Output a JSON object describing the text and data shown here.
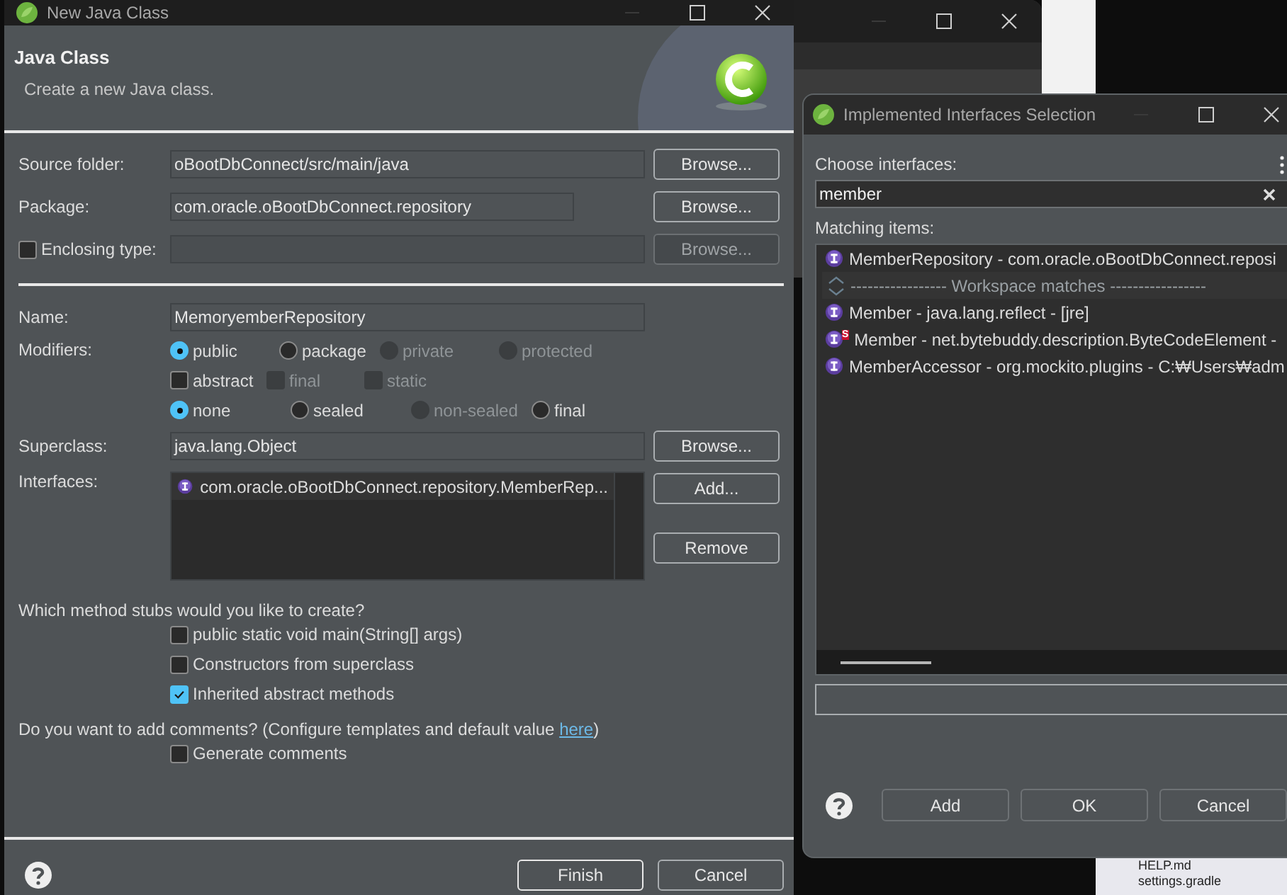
{
  "background": {
    "tree_items": [
      "HELP.md",
      "settings.gradle"
    ]
  },
  "main_dialog": {
    "title": "New Java Class",
    "header": {
      "title": "Java Class",
      "subtitle": "Create a new Java class."
    },
    "source_folder": {
      "label": "Source folder:",
      "value": "oBootDbConnect/src/main/java",
      "button": "Browse..."
    },
    "package": {
      "label": "Package:",
      "value": "com.oracle.oBootDbConnect.repository",
      "button": "Browse..."
    },
    "enclosing_type": {
      "label": "Enclosing type:",
      "checked": false,
      "button": "Browse...",
      "disabled": true
    },
    "name": {
      "label": "Name:",
      "value": "MemoryemberRepository"
    },
    "modifiers": {
      "label": "Modifiers:",
      "visibility": [
        {
          "label": "public",
          "selected": true,
          "disabled": false
        },
        {
          "label": "package",
          "selected": false,
          "disabled": false
        },
        {
          "label": "private",
          "selected": false,
          "disabled": true
        },
        {
          "label": "protected",
          "selected": false,
          "disabled": true
        }
      ],
      "flags": [
        {
          "label": "abstract",
          "checked": false,
          "disabled": false
        },
        {
          "label": "final",
          "checked": false,
          "disabled": true
        },
        {
          "label": "static",
          "checked": false,
          "disabled": true
        }
      ],
      "sealing": [
        {
          "label": "none",
          "selected": true,
          "disabled": false
        },
        {
          "label": "sealed",
          "selected": false,
          "disabled": false
        },
        {
          "label": "non-sealed",
          "selected": false,
          "disabled": true
        },
        {
          "label": "final",
          "selected": false,
          "disabled": false
        }
      ]
    },
    "superclass": {
      "label": "Superclass:",
      "value": "java.lang.Object",
      "button": "Browse..."
    },
    "interfaces": {
      "label": "Interfaces:",
      "items": [
        "com.oracle.oBootDbConnect.repository.MemberRep..."
      ],
      "buttons": [
        "Add...",
        "Remove"
      ]
    },
    "stubs_question": "Which method stubs would you like to create?",
    "stubs": [
      {
        "label": "public static void main(String[] args)",
        "checked": false
      },
      {
        "label": "Constructors from superclass",
        "checked": false
      },
      {
        "label": "Inherited abstract methods",
        "checked": true
      }
    ],
    "comments_question": "Do you want to add comments? (Configure templates and default value ",
    "comments_link": "here",
    "comments_question_end": ")",
    "comments": [
      {
        "label": "Generate comments",
        "checked": false
      }
    ],
    "buttons": [
      {
        "label": "Finish",
        "default": true
      },
      {
        "label": "Cancel",
        "default": false
      }
    ]
  },
  "interfaces_dialog": {
    "title": "Implemented Interfaces Selection",
    "prompt": "Choose interfaces:",
    "search": {
      "value": "member"
    },
    "matching_label": "Matching items:",
    "items": [
      {
        "kind": "interface",
        "name": "MemberRepository",
        "detail": " - com.oracle.oBootDbConnect.reposi",
        "selected": false
      },
      {
        "kind": "separator",
        "name": "----------------- Workspace matches -----------------"
      },
      {
        "kind": "interface",
        "name": "Member",
        "detail": " - java.lang.reflect - [jre]",
        "selected": false
      },
      {
        "kind": "interface",
        "name": "Member",
        "detail": " - net.bytebuddy.description.ByteCodeElement -",
        "badge": "S",
        "selected": false
      },
      {
        "kind": "interface",
        "name": "MemberAccessor",
        "detail": " - org.mockito.plugins - C:₩Users₩adm",
        "selected": false
      }
    ],
    "buttons": [
      "Add",
      "OK",
      "Cancel"
    ]
  }
}
